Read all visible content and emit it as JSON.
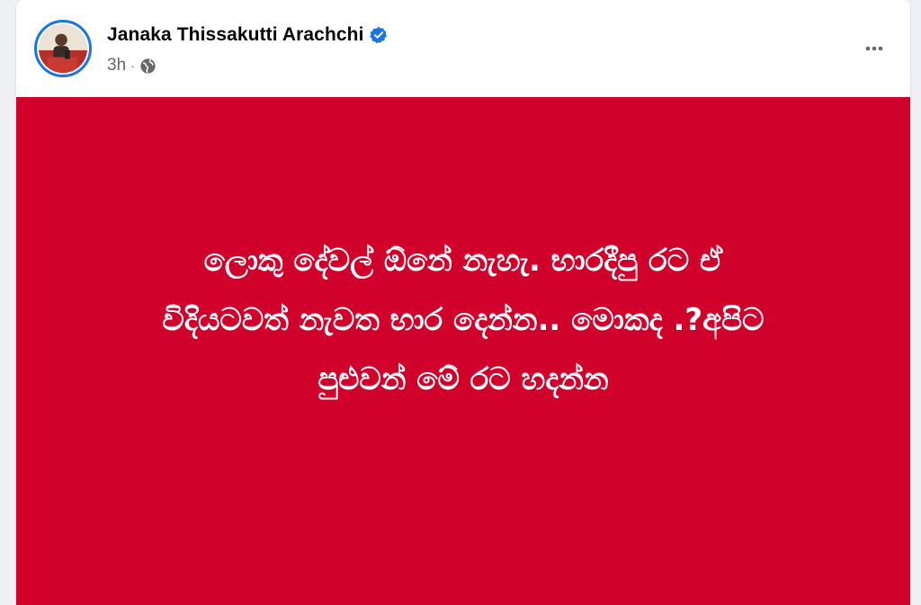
{
  "post": {
    "author": "Janaka Thissakutti Arachchi",
    "time": "3h",
    "separator": "·",
    "privacy_icon": "globe-icon",
    "verified_icon": "verified-badge-icon",
    "more_icon": "more-options-icon",
    "text": "ලොකු දේවල් ඕනේ නැහැ. භාරදීපු රට ඒ\nවිදියටවත් නැවත භාර දෙන්න.. මොකද .?අපිට\nපුළුවන් මේ රට හදන්න",
    "background_color": "#d0022c",
    "text_color": "#ffffff"
  },
  "colors": {
    "verified_blue": "#1b74e4",
    "meta_gray": "#65676b",
    "name_black": "#050505"
  }
}
